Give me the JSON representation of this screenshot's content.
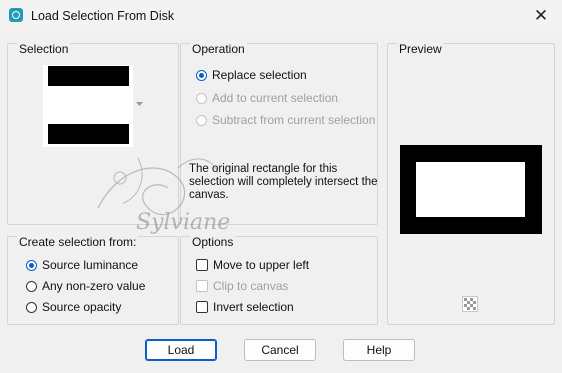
{
  "window": {
    "title": "Load Selection From Disk",
    "close_glyph": "✕"
  },
  "selection_group": {
    "label": "Selection"
  },
  "operation_group": {
    "label": "Operation",
    "options": [
      {
        "label": "Replace selection",
        "checked": true,
        "enabled": true
      },
      {
        "label": "Add to current selection",
        "checked": false,
        "enabled": false
      },
      {
        "label": "Subtract from current selection",
        "checked": false,
        "enabled": false
      }
    ],
    "note": "The original rectangle for this selection will completely intersect the canvas."
  },
  "preview_group": {
    "label": "Preview"
  },
  "create_group": {
    "label": "Create selection from:",
    "options": [
      {
        "label": "Source luminance",
        "checked": true
      },
      {
        "label": "Any non-zero value",
        "checked": false
      },
      {
        "label": "Source opacity",
        "checked": false
      }
    ]
  },
  "options_group": {
    "label": "Options",
    "items": [
      {
        "label": "Move to upper left",
        "checked": false,
        "enabled": true
      },
      {
        "label": "Clip to canvas",
        "checked": false,
        "enabled": false
      },
      {
        "label": "Invert selection",
        "checked": false,
        "enabled": true
      }
    ]
  },
  "buttons": {
    "load": "Load",
    "cancel": "Cancel",
    "help": "Help"
  },
  "watermark": "Sylviane",
  "colors": {
    "accent": "#0b5ec8",
    "disabled": "#a0a0a0",
    "icon": "#1f9bb8"
  },
  "icons": [
    "app-icon",
    "close-icon",
    "dropdown-arrow-icon",
    "checkerboard-icon"
  ]
}
